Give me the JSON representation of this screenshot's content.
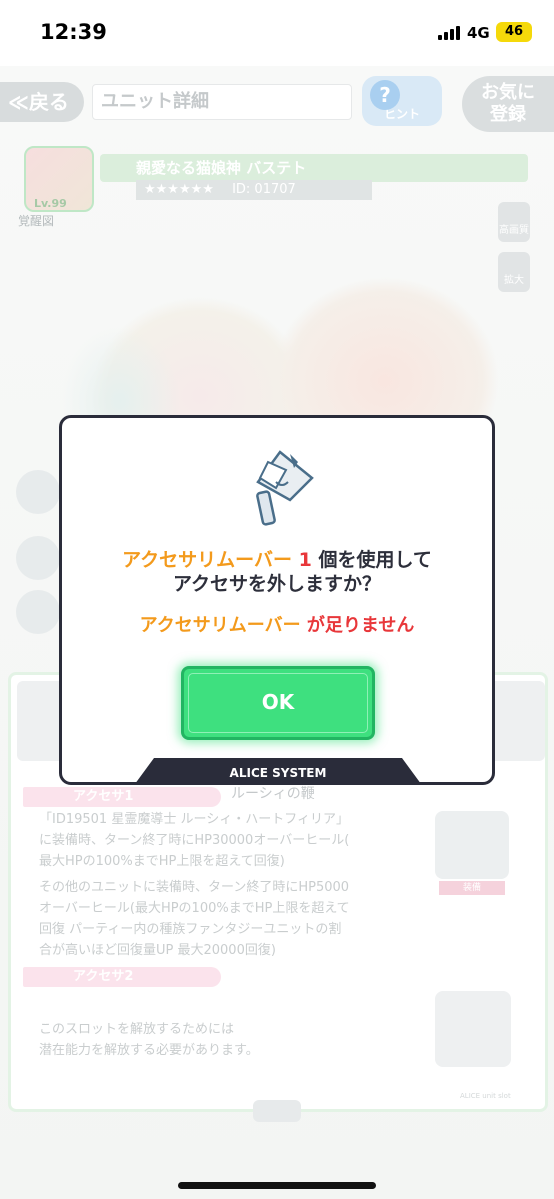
{
  "status_bar": {
    "time": "12:39",
    "network": "4G",
    "battery": "46"
  },
  "header": {
    "back_label": "≪戻る",
    "title": "ユニット詳細",
    "hint_label": "ヒント",
    "favorite_label": "お気に\n登録"
  },
  "unit": {
    "name": "親愛なる猫娘神 バステト",
    "stars": "★★★★★★",
    "id": "ID: 01707",
    "level": "Lv.99",
    "awaken_label": "覚醒図"
  },
  "side_buttons": [
    "高画質",
    "拡大"
  ],
  "panel": {
    "accessory1_tag": "アクセサ1",
    "accessory1_name": "ルーシィの鞭",
    "accessory1_text": "「ID19501 星霊魔導士 ルーシィ・ハートフィリア」\nに装備時、ターン終了時にHP30000オーバーヒール(\n最大HPの100%までHP上限を超えて回復)",
    "accessory1_text2": "その他のユニットに装備時、ターン終了時にHP5000\nオーバーヒール(最大HPの100%までHP上限を超えて\n回復 パーティー内の種族ファンタジーユニットの割\n合が高いほど回復量UP 最大20000回復)",
    "equipped_badge": "装備",
    "accessory2_tag": "アクセサ2",
    "accessory2_text": "このスロットを解放するためには\n潜在能力を解放する必要があります。",
    "footer_mark": "ALICE unit slot"
  },
  "dialog": {
    "item_name": "アクセサリムーバー",
    "count": "1",
    "msg_part1": "個を使用して",
    "msg_line2": "アクセサを外しますか？",
    "shortage_item": "アクセサリムーバー",
    "shortage_text": "が足りません",
    "ok_label": "OK",
    "footer": "ALICE SYSTEM",
    "colors": {
      "accent_orange": "#f39a1c",
      "warning_red": "#e8373a",
      "ok_green": "#3ee07f",
      "frame": "#2a2c3a"
    }
  }
}
